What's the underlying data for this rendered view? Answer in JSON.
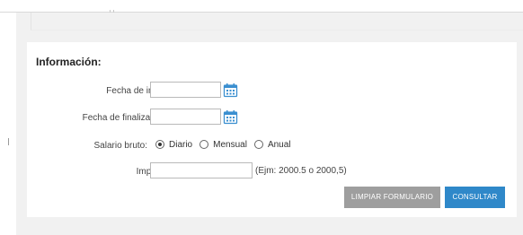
{
  "form": {
    "title": "Información:",
    "fields": {
      "fecha_inicio": {
        "label": "Fecha de inicio: *",
        "value": ""
      },
      "fecha_fin": {
        "label": "Fecha de finalización: *",
        "value": ""
      },
      "salario": {
        "label": "Salario bruto:",
        "options": [
          {
            "label": "Diario",
            "checked": true
          },
          {
            "label": "Mensual",
            "checked": false
          },
          {
            "label": "Anual",
            "checked": false
          }
        ]
      },
      "importe": {
        "label": "Importe: *",
        "value": "",
        "hint": "(Ejm: 2000.5 o 2000,5)"
      }
    },
    "buttons": {
      "clear": "LIMPIAR FORMULARIO",
      "submit": "CONSULTAR"
    }
  },
  "colors": {
    "primary": "#2f88c9",
    "secondary": "#9e9e9e",
    "page_background": "#f1f1f1",
    "calendar_icon": "#3a8fd0"
  }
}
